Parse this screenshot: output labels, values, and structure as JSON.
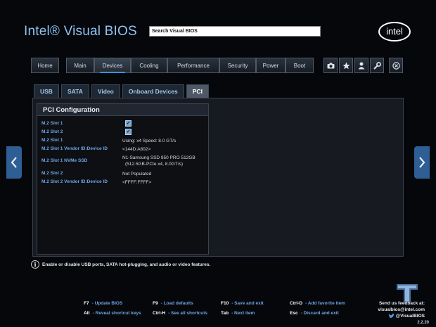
{
  "brand": "Intel® Visual BIOS",
  "search": {
    "value": "Search Visual BIOS"
  },
  "logo_text": "intel",
  "nav": {
    "home": "Home",
    "items": [
      "Main",
      "Devices",
      "Cooling",
      "Performance",
      "Security",
      "Power",
      "Boot"
    ],
    "active": "Devices",
    "icons": [
      "camera-icon",
      "star-icon",
      "user-icon",
      "wrench-icon"
    ],
    "close_icon": "close-icon"
  },
  "tabs": [
    "USB",
    "SATA",
    "Video",
    "Onboard Devices",
    "PCI"
  ],
  "active_tab": "PCI",
  "pci": {
    "title": "PCI Configuration",
    "rows": [
      {
        "label": "M.2 Slot 1",
        "type": "checkbox",
        "checked": true
      },
      {
        "label": "M.2 Slot 2",
        "type": "checkbox",
        "checked": true
      },
      {
        "label": "M.2 Slot 1",
        "value": "Using: x4  Speed: 8.0 GT/s"
      },
      {
        "label": "M.2 Slot 1 Vendor ID:Device ID",
        "value": "<144D:A802>"
      },
      {
        "label": "M.2 Slot 1 NVMe SSD",
        "value": "N1-Samsung SSD 950 PRO 512GB",
        "value2": "(512.5GB-PCIe x4, 8.0GT/s)"
      },
      {
        "label": "M.2 Slot 2",
        "value": "Not Populated"
      },
      {
        "label": "M.2 Slot 2 Vendor ID:Device ID",
        "value": "<FFFF:FFFF>"
      }
    ]
  },
  "help_text": "Enable or disable USB ports, SATA hot-plugging, and audio or video features.",
  "hints": [
    {
      "key": "F7",
      "desc": "- Update BIOS"
    },
    {
      "key": "F9",
      "desc": "- Load defaults"
    },
    {
      "key": "F10",
      "desc": "- Save and exit"
    },
    {
      "key": "Ctrl-D",
      "desc": "- Add favorite item"
    },
    {
      "key": "Alt",
      "desc": "- Reveal shortcut keys"
    },
    {
      "key": "Ctrl-H",
      "desc": "- See all shortcuts"
    },
    {
      "key": "Tab",
      "desc": "- Next item"
    },
    {
      "key": "Esc",
      "desc": "- Discard and exit"
    }
  ],
  "social": {
    "line1": "Send us feedback at:",
    "line2": "visualbios@intel.com",
    "line3": "@VisualBIOS"
  },
  "version": "2.2.20",
  "colors": {
    "accent": "#3e8fe0",
    "label": "#6fa6e4",
    "arrow": "#2e5e93"
  }
}
